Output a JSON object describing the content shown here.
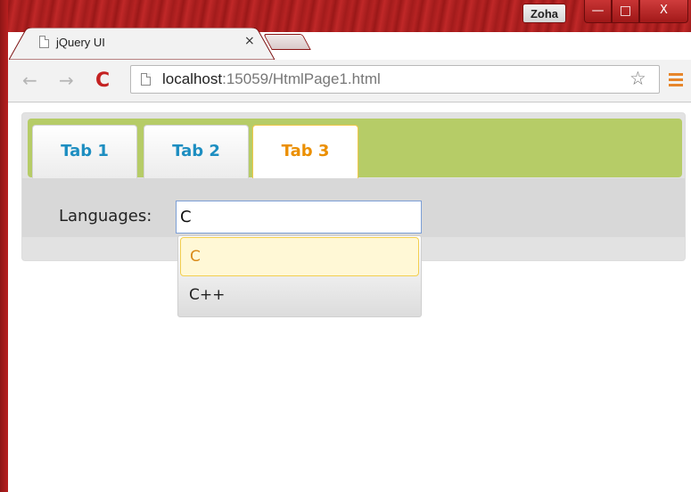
{
  "browser": {
    "profile_name": "Zoha",
    "window_controls": {
      "minimize": "—",
      "maximize": "□",
      "close": "X"
    },
    "tab": {
      "title": "jQuery UI",
      "close_glyph": "×"
    },
    "url_host": "localhost",
    "url_rest": ":15059/HtmlPage1.html",
    "icons": [
      "back-arrow-icon",
      "forward-arrow-icon",
      "reload-icon",
      "page-icon",
      "star-icon",
      "menu-icon"
    ],
    "nav": {
      "back": "←",
      "forward": "→",
      "reload": "C",
      "star": "☆"
    }
  },
  "tabs": {
    "items": [
      {
        "label": "Tab 1",
        "active": false
      },
      {
        "label": "Tab 2",
        "active": false
      },
      {
        "label": "Tab 3",
        "active": true
      }
    ],
    "header_color": "#b6cc67",
    "active_color": "#eb8f00",
    "inactive_color": "#1d8ec1"
  },
  "panel": {
    "languages_label": "Languages:",
    "input_value": "C"
  },
  "autocomplete": {
    "items": [
      "C",
      "C++"
    ],
    "highlighted_index": 0
  }
}
